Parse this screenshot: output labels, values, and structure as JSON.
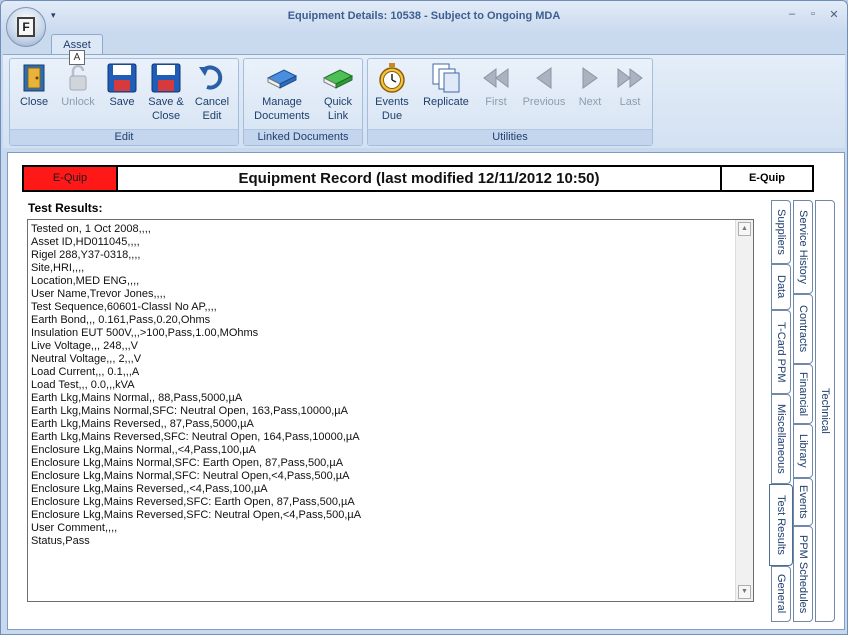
{
  "window": {
    "title": "Equipment Details: 10538 - Subject to Ongoing MDA",
    "orb_letter": "F",
    "qat_glyph": "▾"
  },
  "window_buttons": {
    "minimize": "–",
    "restore": "▫",
    "close": "✕"
  },
  "ribbon": {
    "tab": "Asset",
    "keytip": "A",
    "groups": {
      "edit": {
        "label": "Edit",
        "close": "Close",
        "unlock": "Unlock",
        "save": "Save",
        "save_close_1": "Save &",
        "save_close_2": "Close",
        "cancel_1": "Cancel",
        "cancel_2": "Edit"
      },
      "linked": {
        "label": "Linked Documents",
        "manage_1": "Manage",
        "manage_2": "Documents",
        "quick_1": "Quick",
        "quick_2": "Link"
      },
      "utilities": {
        "label": "Utilities",
        "events_1": "Events",
        "events_2": "Due",
        "replicate": "Replicate",
        "first": "First",
        "previous": "Previous",
        "next": "Next",
        "last": "Last"
      }
    }
  },
  "record": {
    "left_badge": "E-Quip",
    "title": "Equipment Record (last modified 12/11/2012 10:50)",
    "right_badge": "E-Quip"
  },
  "results": {
    "label": "Test Results:",
    "lines": [
      "Tested on, 1 Oct 2008,,,,",
      "Asset ID,HD011045,,,,",
      "Rigel 288,Y37-0318,,,,",
      "Site,HRI,,,,",
      "Location,MED ENG,,,,",
      "User Name,Trevor Jones,,,,",
      "Test Sequence,60601-ClassI No AP,,,,",
      "Earth Bond,,, 0.161,Pass,0.20,Ohms",
      "Insulation EUT 500V,,,>100,Pass,1.00,MOhms",
      "Live Voltage,,, 248,,,V",
      "Neutral Voltage,,, 2,,,V",
      "Load Current,,, 0.1,,,A",
      "Load Test,,, 0.0,,,kVA",
      "Earth Lkg,Mains Normal,, 88,Pass,5000,µA",
      "Earth Lkg,Mains Normal,SFC: Neutral Open, 163,Pass,10000,µA",
      "Earth Lkg,Mains Reversed,, 87,Pass,5000,µA",
      "Earth Lkg,Mains Reversed,SFC: Neutral Open, 164,Pass,10000,µA",
      "Enclosure Lkg,Mains Normal,,<4,Pass,100,µA",
      "Enclosure Lkg,Mains Normal,SFC: Earth Open, 87,Pass,500,µA",
      "Enclosure Lkg,Mains Normal,SFC: Neutral Open,<4,Pass,500,µA",
      "Enclosure Lkg,Mains Reversed,,<4,Pass,100,µA",
      "Enclosure Lkg,Mains Reversed,SFC: Earth Open, 87,Pass,500,µA",
      "Enclosure Lkg,Mains Reversed,SFC: Neutral Open,<4,Pass,500,µA",
      "User Comment,,,,",
      "Status,Pass"
    ]
  },
  "side_tabs": {
    "col1": [
      "Suppliers",
      "Data",
      "T-Card PPM",
      "Miscellaneous",
      "Test Results",
      "General"
    ],
    "col2": [
      "Service History",
      "Contracts",
      "Financial",
      "Library",
      "Events",
      "PPM Schedules"
    ],
    "col3": [
      "Technical"
    ]
  },
  "colors": {
    "accent": "#1e3f6c",
    "equip_red": "#ff1818"
  }
}
